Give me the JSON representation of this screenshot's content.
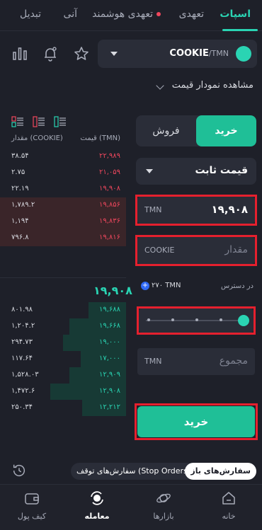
{
  "tabs": [
    {
      "label": "اسپات",
      "active": true
    },
    {
      "label": "تعهدی",
      "active": false
    },
    {
      "label": "تعهدی هوشمند",
      "active": false
    },
    {
      "label": "آنی",
      "active": false
    },
    {
      "label": "تبدیل",
      "active": false
    }
  ],
  "market": {
    "base": "COOKIE",
    "quote": "/TMN",
    "icons": [
      "cookie-coin-icon",
      "chevron-down-icon",
      "star-icon",
      "bell-icon",
      "bar-chart-icon"
    ]
  },
  "chart_toggle": {
    "label": "مشاهده نمودار قیمت"
  },
  "orderbook": {
    "header_price": "قیمت (TMN)",
    "header_amount": "مقدار (COOKIE)",
    "asks": [
      {
        "price": "۲۲,۹۸۹",
        "amount": "۳۸.۵۴"
      },
      {
        "price": "۲۱,۰۵۹",
        "amount": "۲.۷۵"
      },
      {
        "price": "۱۹,۹۰۸",
        "amount": "۲۲.۱۹"
      },
      {
        "price": "۱۹,۸۵۶",
        "amount": "۱,۷۸۹.۲"
      },
      {
        "price": "۱۹,۸۳۶",
        "amount": "۱,۱۹۴"
      },
      {
        "price": "۱۹,۸۱۶",
        "amount": "۷۹۶.۸"
      }
    ],
    "last_price": "۱۹,۹۰۸",
    "bids": [
      {
        "price": "۱۹,۶۸۸",
        "amount": "۸۰۱.۹۸",
        "depth": 0.3
      },
      {
        "price": "۱۹,۶۶۸",
        "amount": "۱,۲۰۴.۲",
        "depth": 0.45
      },
      {
        "price": "۱۹,۰۰۰",
        "amount": "۲۹۴.۷۳",
        "depth": 0.5
      },
      {
        "price": "۱۷,۰۰۰",
        "amount": "۱۱۷.۶۴",
        "depth": 0.36
      },
      {
        "price": "۱۲,۹۰۹",
        "amount": "۱,۵۲۸.۰۳",
        "depth": 0.45
      },
      {
        "price": "۱۲,۹۰۸",
        "amount": "۱,۴۷۲.۶",
        "depth": 0.6
      },
      {
        "price": "۱۲,۲۱۲",
        "amount": "۲۵۰.۳۴",
        "depth": 0.35
      }
    ]
  },
  "form": {
    "buy_label": "خرید",
    "sell_label": "فروش",
    "order_type": "قیمت ثابت",
    "price_unit": "TMN",
    "price_value": "۱۹,۹۰۸",
    "amount_unit": "COOKIE",
    "amount_placeholder": "مقدار",
    "available_label": "در دسترس",
    "available_value": "۲۷۰ TMN",
    "slider_value": 1.0,
    "total_unit": "TMN",
    "total_placeholder": "مجموع",
    "submit_label": "خرید"
  },
  "orders_bar": {
    "open_orders": "سفارش‌های باز",
    "stop_orders": "سفارش‌های توقف (Stop Orders)"
  },
  "nav": [
    {
      "label": "کیف پول",
      "icon": "wallet-icon",
      "active": false
    },
    {
      "label": "معامله",
      "icon": "trade-icon",
      "active": true
    },
    {
      "label": "بازارها",
      "icon": "markets-icon",
      "active": false
    },
    {
      "label": "خانه",
      "icon": "home-icon",
      "active": false
    }
  ],
  "colors": {
    "accent": "#2ad4b3",
    "sell": "#f0475d",
    "highlight": "#e5202e"
  }
}
